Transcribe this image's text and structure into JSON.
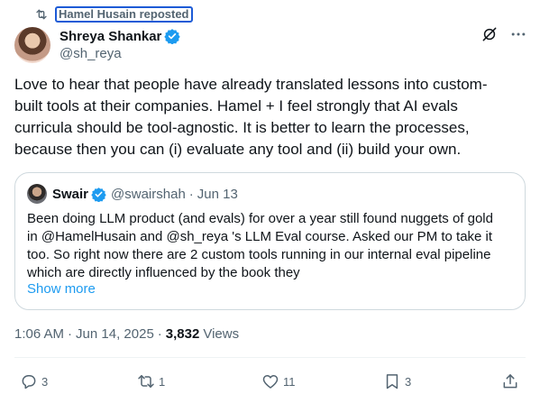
{
  "repost": {
    "text": "Hamel Husain reposted",
    "icon": "repost-icon"
  },
  "author": {
    "name": "Shreya Shankar",
    "handle": "@sh_reya",
    "verified_icon": "verified-badge-icon"
  },
  "top_actions": {
    "grok_icon": "grok-icon",
    "more_icon": "more-options-icon"
  },
  "tweet": {
    "text": "Love to hear that people have already translated lessons into custom-\nbuilt tools at their companies. Hamel + I feel strongly that AI evals\ncurricula should be tool-agnostic. It is better to learn the processes,\nbecause then you can (i) evaluate any tool and (ii) build your own."
  },
  "quote": {
    "name": "Swair",
    "handle": "@swairshah",
    "separator": "·",
    "date": "Jun 13",
    "text": "Been doing LLM product (and evals) for over a year still found nuggets of gold\nin @HamelHusain and @sh_reya 's LLM Eval course. Asked our PM to take it\ntoo. So right now there are 2 custom tools running in our internal eval pipeline\nwhich are directly influenced by the book they",
    "show_more": "Show more"
  },
  "meta": {
    "time": "1:06 AM",
    "dot1": "·",
    "date": "Jun 14, 2025",
    "dot2": "·",
    "views_count": "3,832",
    "views_label": "Views"
  },
  "actions": {
    "replies": "3",
    "reposts": "1",
    "likes": "11",
    "bookmarks": "3"
  },
  "colors": {
    "text_primary": "#0f1419",
    "text_secondary": "#536471",
    "accent_blue": "#1d9bf0",
    "border": "#cfd9de"
  }
}
